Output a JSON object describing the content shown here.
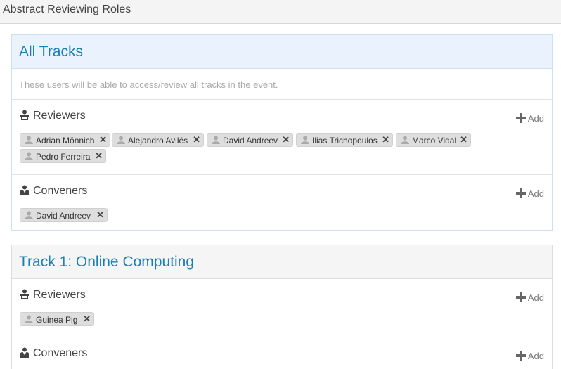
{
  "page": {
    "title": "Abstract Reviewing Roles"
  },
  "panels": [
    {
      "heading": "All Tracks",
      "description": "These users will be able to access/review all tracks in the event.",
      "reviewers": {
        "label": "Reviewers",
        "add_label": "Add",
        "users": [
          "Adrian Mönnich",
          "Alejandro Avilés",
          "David Andreev",
          "Ilias Trichopoulos",
          "Marco Vidal",
          "Pedro Ferreira"
        ]
      },
      "conveners": {
        "label": "Conveners",
        "add_label": "Add",
        "users": [
          "David Andreev"
        ]
      }
    },
    {
      "heading": "Track 1: Online Computing",
      "reviewers": {
        "label": "Reviewers",
        "add_label": "Add",
        "users": [
          "Guinea Pig"
        ]
      },
      "conveners": {
        "label": "Conveners",
        "add_label": "Add",
        "users": []
      }
    }
  ],
  "icons": {
    "reviewers": "reviewer-icon",
    "conveners": "convener-icon",
    "add": "plus-icon",
    "user": "user-icon",
    "remove": "remove-icon"
  },
  "remove_glyph": "✕",
  "colors": {
    "heading": "#1a7fb4",
    "all_tracks_header_bg": "#e9f2fd",
    "chip_bg": "#dedede"
  }
}
